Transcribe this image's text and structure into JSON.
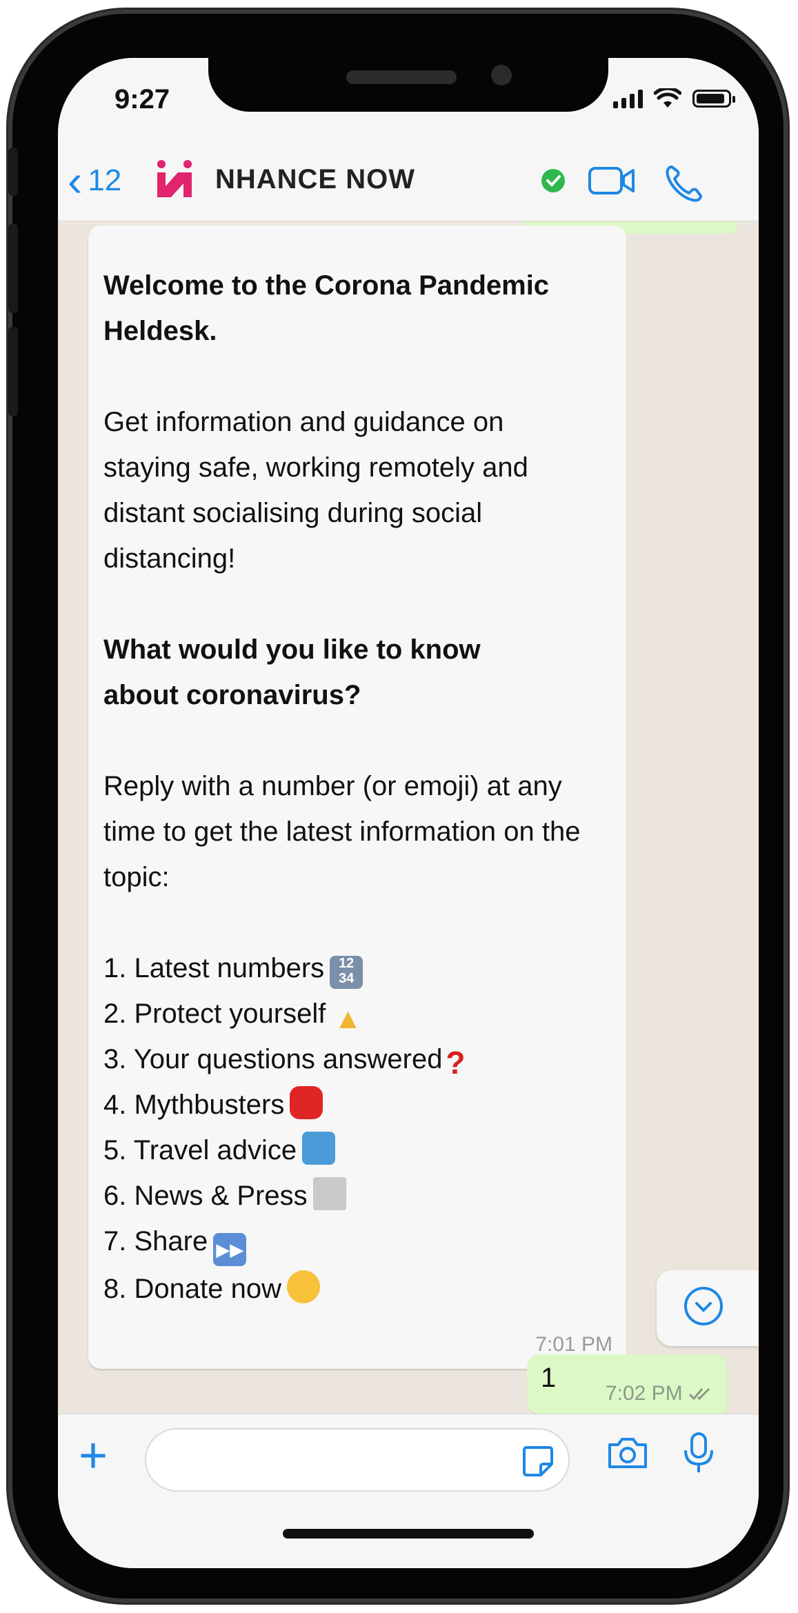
{
  "status_bar": {
    "time": "9:27"
  },
  "header": {
    "back_count": "12",
    "contact_name": "NHANCE NOW",
    "colors": {
      "accent": "#1e88e5",
      "verified": "#2eb84c",
      "logo": "#e0246d"
    }
  },
  "chat": {
    "incoming": {
      "title": "Welcome to the Corona Pandemic Heldesk.",
      "intro": "Get information and guidance on staying safe, working remotely and distant socialising during social distancing!",
      "question": "What would you like to know about coronavirus?",
      "instruction": "Reply with a number (or emoji) at any time to get the latest information on the topic:",
      "menu": [
        {
          "label": "1. Latest numbers",
          "icon": "numbers-icon"
        },
        {
          "label": "2. Protect yourself",
          "icon": "thumbs-up-icon"
        },
        {
          "label": "3. Your questions answered",
          "icon": "question-mark-icon"
        },
        {
          "label": "4. Mythbusters",
          "icon": "stop-sign-icon"
        },
        {
          "label": "5. Travel advice",
          "icon": "map-icon"
        },
        {
          "label": "6. News & Press",
          "icon": "newspaper-icon"
        },
        {
          "label": "7. Share",
          "icon": "fast-forward-icon"
        },
        {
          "label": "8. Donate now",
          "icon": "smiling-hearts-icon"
        }
      ],
      "time": "7:01 PM"
    },
    "outgoing": {
      "text": "1",
      "time": "7:02 PM"
    }
  }
}
